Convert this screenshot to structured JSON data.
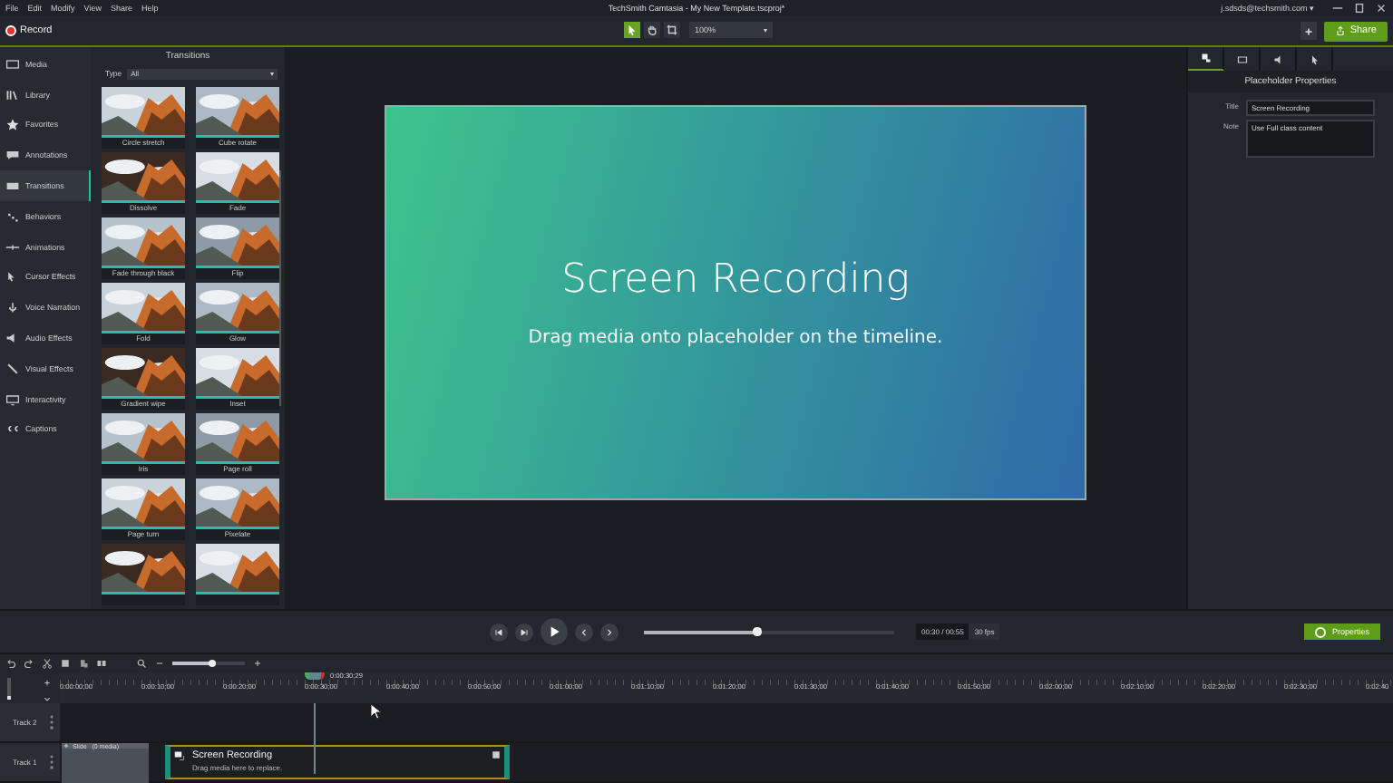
{
  "menu": [
    "File",
    "Edit",
    "Modify",
    "View",
    "Share",
    "Help"
  ],
  "window": {
    "title": "TechSmith Camtasia - My New Template.tscproj*",
    "account": "j.sdsds@techsmith.com ▾"
  },
  "toolbar": {
    "record": "Record",
    "tools": [
      {
        "selected": true
      },
      {
        "selected": false
      },
      {
        "selected": false
      }
    ],
    "zoom": "100%",
    "share": "Share"
  },
  "sidebar": {
    "items": [
      {
        "label": "Media",
        "selected": false
      },
      {
        "label": "Library",
        "selected": false
      },
      {
        "label": "Favorites",
        "selected": false
      },
      {
        "label": "Annotations",
        "selected": false
      },
      {
        "label": "Transitions",
        "selected": true
      },
      {
        "label": "Behaviors",
        "selected": false
      },
      {
        "label": "Animations",
        "selected": false
      },
      {
        "label": "Cursor Effects",
        "selected": false
      },
      {
        "label": "Voice Narration",
        "selected": false
      },
      {
        "label": "Audio Effects",
        "selected": false
      },
      {
        "label": "Visual Effects",
        "selected": false
      },
      {
        "label": "Interactivity",
        "selected": false
      },
      {
        "label": "Captions",
        "selected": false
      }
    ]
  },
  "transitions": {
    "title": "Transitions",
    "type_label": "Type",
    "type_value": "All",
    "items": [
      {
        "label": "Circle stretch"
      },
      {
        "label": "Cube rotate"
      },
      {
        "label": "Dissolve"
      },
      {
        "label": "Fade"
      },
      {
        "label": "Fade through black"
      },
      {
        "label": "Flip"
      },
      {
        "label": "Fold"
      },
      {
        "label": "Glow"
      },
      {
        "label": "Gradient wipe"
      },
      {
        "label": "Inset"
      },
      {
        "label": "Iris"
      },
      {
        "label": "Page roll"
      },
      {
        "label": "Page turn"
      },
      {
        "label": "Pixelate"
      },
      {
        "kind": "picture"
      },
      {
        "kind": "picture"
      }
    ]
  },
  "canvas": {
    "title": "Screen Recording",
    "subtitle": "Drag media onto placeholder on the timeline."
  },
  "properties": {
    "tabs": [
      {
        "selected": true
      },
      {
        "selected": false
      },
      {
        "selected": false
      },
      {
        "selected": false
      }
    ],
    "title": "Placeholder Properties",
    "fields": [
      {
        "label": "Title",
        "value": "Screen Recording"
      },
      {
        "label": "Note",
        "value": "Use Full class content"
      }
    ]
  },
  "player": {
    "level": 0.45,
    "time": "00:30 / 00:55",
    "fps": "30 fps",
    "properties_button": "Properties"
  },
  "timeline": {
    "zoom_slider": {
      "level": 0.55
    },
    "track_height": {
      "level": 0.2
    },
    "playhead": "0:00:30;29",
    "ruler": [
      "0:00:00;00",
      "0:00:10;00",
      "0:00:20;00",
      "0:00:30;00",
      "0:00:40;00",
      "0:00:50;00",
      "0:01:00;00",
      "0:01:10;00",
      "0:01:20;00",
      "0:01:30;00",
      "0:01:40;00",
      "0:01:50;00",
      "0:02:00;00",
      "0:02:10;00",
      "0:02:20;00",
      "0:02:30;00",
      "0:02:40"
    ],
    "tracks": [
      {
        "name": "Track 2"
      },
      {
        "name": "Track 1",
        "group": {
          "name": "Slide",
          "count": "(0 media)"
        },
        "placeholder": {
          "title": "Screen Recording",
          "note": "Drag media here to replace."
        }
      }
    ]
  }
}
